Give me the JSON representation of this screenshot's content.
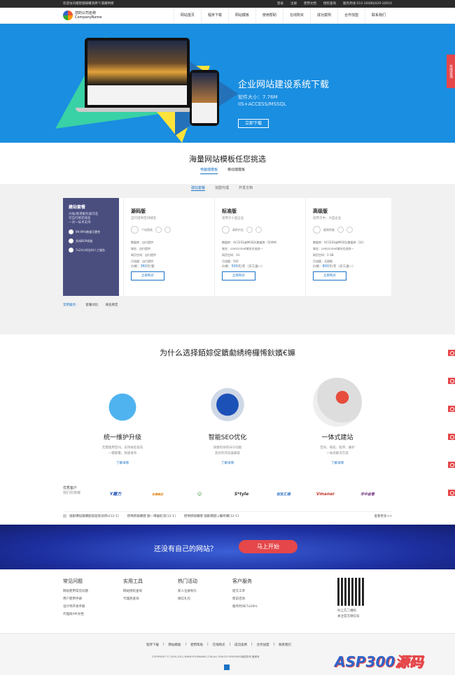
{
  "topbar": {
    "welcome": "欢迎访问鍚嶅煄鍚嶆湇鍔℃満鍖哄煙",
    "right": [
      "登录",
      "注册",
      "使用文档",
      "授权查询"
    ],
    "hotline": "服务热线 010-10086|029-10010"
  },
  "logo": {
    "name": "您的公司名称",
    "sub": "CompanyName"
  },
  "nav": [
    "网站首页",
    "程序下载",
    "网站模板",
    "使用帮助",
    "在线购买",
    "成功案例",
    "合作加盟",
    "联系我们"
  ],
  "hero": {
    "title": "企业网站建设系统下载",
    "size": "软件大小：7.76M",
    "platform": "IIS+ACCESS/MSSQL",
    "button": "立即下载"
  },
  "float_tab": "在线咨询",
  "templates": {
    "title": "海量网站模板任您挑选",
    "tabs": [
      {
        "label": "电脑端模板",
        "active": true
      },
      {
        "label": "移动端模板",
        "active": false
      }
    ]
  },
  "sub_tabs": [
    {
      "label": "建站套餐",
      "active": true
    },
    {
      "label": "加盟代理",
      "active": false
    },
    {
      "label": "开发文档",
      "active": false
    }
  ],
  "package": {
    "title": "建站套餐",
    "lines": [
      "大陆/香港服务器可选",
      "可自行绑定域名",
      "一对一技术支持"
    ],
    "features": [
      "99.99%数据可靠性",
      "多线BGP线路",
      "7x24小时全时人工服务"
    ]
  },
  "plans": [
    {
      "name": "源码版",
      "desc": "自行提供空间域名",
      "tag": "个站首选",
      "specs": [
        "数据库：自行提供",
        "域名：自行提供",
        "网页空间：自行提供",
        "月流量：自行提供"
      ],
      "price_prefix": "价格：",
      "price": "360",
      "price_unit": "元/套",
      "buy": "立即购买"
    },
    {
      "name": "标准版",
      "desc": "适用于小型企业",
      "tag": "高性价比",
      "specs": [
        "数据库：ACCESS或MSSQL数据库（500M）",
        "域名：com/cn/net域名任选其一",
        "网页空间：1G",
        "月流量：500"
      ],
      "price_prefix": "价格：",
      "price": "500",
      "price_unit": "元/年（买三送一）",
      "buy": "立即购买"
    },
    {
      "name": "高级版",
      "desc": "适用于中、大型企业",
      "tag": "超高性能",
      "specs": [
        "数据库：ACCESS或MSSQL数据库（1G）",
        "域名：com/cn/net域名任选其一",
        "网页空间：3 GB",
        "月流量：无限制"
      ],
      "price_prefix": "价格：",
      "price": "800",
      "price_unit": "元/年（买三送一）",
      "buy": "立即购买"
    }
  ],
  "services": {
    "label": "常用服务：",
    "items": [
      "套餐对比",
      "域名绑定"
    ]
  },
  "why": {
    "title": "为什么选择銆婃促鐀勮綉绔欏悕鈥嬪€嫲",
    "items": [
      {
        "title": "统一维护升级",
        "desc": [
          "无需租用空间，支持域名指向",
          "一键部署，快速发布"
        ],
        "more": "了解详情"
      },
      {
        "title": "智能SEO优化",
        "desc": [
          "快捷有效的SEO功能",
          "友好的浏览器兼容"
        ],
        "more": "了解详情"
      },
      {
        "title": "一体式建站",
        "desc": [
          "空间、域名、程序、維护",
          "一站式解决方案"
        ],
        "more": "了解详情"
      }
    ]
  },
  "clients": {
    "label": "优秀客户",
    "sub": "我们的荣耀",
    "logos": [
      "Y建力",
      "金鹰集团",
      "☺",
      "S*tyle",
      "创生汇森",
      "Vmaner",
      "华中金管"
    ]
  },
  "ticker": {
    "items": [
      "缁勫瓙绉帽鐨勫笢銆傛湇鍔¤[12-1]",
      "搢鳴绑鍚嶆煡 鍦ㄧ嚎鏀舵湇[12-1]",
      "搢鳴绑鍚嶆煡 缁勫瓙鍥ㄩ槦绔欏[12-1]"
    ],
    "more": "查看更多>>"
  },
  "cta": {
    "question": "还没有自己的网站？",
    "button": "马上开始"
  },
  "footer": {
    "cols": [
      {
        "h": "常见问题",
        "items": [
          "网站使用常见问题",
          "用户使用手册",
          "设计师开发手册",
          "代理商API文档"
        ]
      },
      {
        "h": "实用工具",
        "items": [
          "网站授权查询",
          "代理商查询"
        ]
      },
      {
        "h": "热门活动",
        "items": [
          "新人注册有礼",
          "微信礼包"
        ]
      },
      {
        "h": "客户服务",
        "items": [
          "提交工单",
          "售前咨询",
          "服务时间(7x24h)"
        ]
      }
    ],
    "qr_lines": [
      "扫上方二维码",
      "关注官方微信号"
    ],
    "links": [
      "程序下载",
      "网站模板",
      "使用帮助",
      "在线购买",
      "成功案例",
      "合作加盟",
      "联系我们"
    ],
    "copyright": "COPYRIGHT © 2009-2011,WWW.YOURNAME.COM,ALL RIGHTS RESERVED版权所有",
    "icp": "备案号"
  },
  "watermark": {
    "text": "ASP300",
    "accent": "源码"
  },
  "colors": {
    "primary": "#1a72c5",
    "accent": "#e5474a",
    "hero_bg": "#1a8ee0",
    "package_bg": "#4a4e7f"
  }
}
